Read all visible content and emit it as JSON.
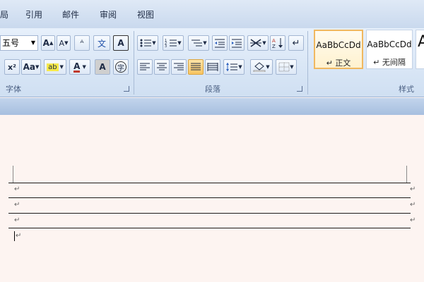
{
  "menu": {
    "tabs": [
      "局",
      "引用",
      "邮件",
      "审阅",
      "视图"
    ]
  },
  "font_group": {
    "font_size": "五号",
    "grow_font": "A",
    "shrink_font": "A",
    "clear_format": "ᴬ",
    "phonetic": "文",
    "char_border": "A",
    "superscript": "x²",
    "change_case": "Aa",
    "highlight": "ab",
    "font_color": "A",
    "char_shading": "A",
    "enclose": "字",
    "label": "字体"
  },
  "paragraph_group": {
    "label": "段落"
  },
  "styles_group": {
    "label": "样式",
    "cards": [
      {
        "sample": "AaBbCcDd",
        "name": "↵ 正文"
      },
      {
        "sample": "AaBbCcDd",
        "name": "↵ 无间隔"
      },
      {
        "sample": "A",
        "name": ""
      }
    ]
  },
  "document": {
    "paragraph_mark": "↵"
  },
  "colors": {
    "highlight": "#f6e94a",
    "font_color": "#c0392b",
    "active_style_border": "#f0b860"
  }
}
